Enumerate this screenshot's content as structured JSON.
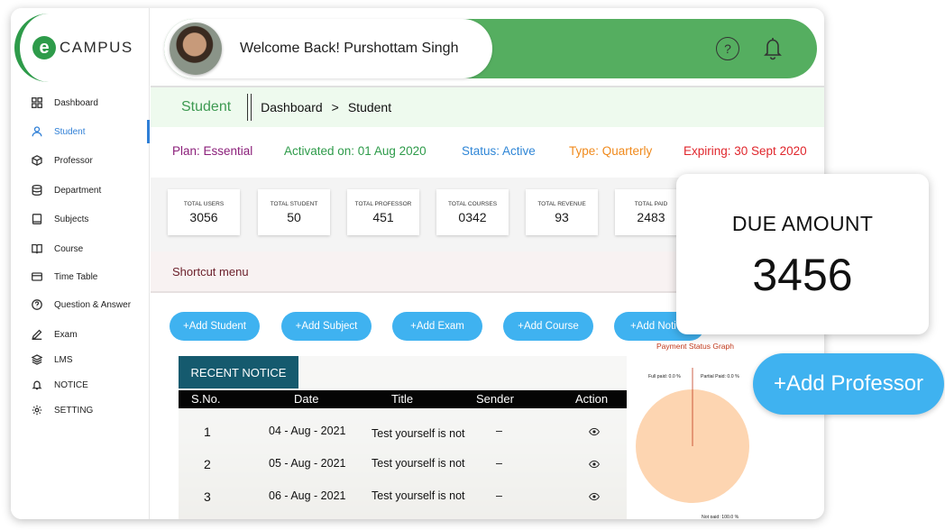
{
  "logo": {
    "badge": "e",
    "text": "CAMPUS"
  },
  "sidebar": {
    "items": [
      {
        "label": "Dashboard",
        "icon": "grid-icon"
      },
      {
        "label": "Student",
        "icon": "user-icon",
        "active": true
      },
      {
        "label": "Professor",
        "icon": "cube-icon"
      },
      {
        "label": "Department",
        "icon": "database-icon"
      },
      {
        "label": "Subjects",
        "icon": "book-icon"
      },
      {
        "label": "Course",
        "icon": "open-book-icon"
      },
      {
        "label": "Time Table",
        "icon": "card-icon"
      },
      {
        "label": "Question & Answer",
        "icon": "question-icon"
      },
      {
        "label": "Exam",
        "icon": "pen-icon"
      },
      {
        "label": "LMS",
        "icon": "layers-icon"
      },
      {
        "label": "NOTICE",
        "icon": "bell-icon"
      },
      {
        "label": "SETTING",
        "icon": "gear-icon"
      }
    ]
  },
  "header": {
    "welcome": "Welcome Back! Purshottam Singh",
    "help": "?"
  },
  "breadcrumb": {
    "section": "Student",
    "root": "Dashboard",
    "arrow": ">",
    "current": "Student"
  },
  "plan": {
    "plan": "Plan: Essential",
    "activated": "Activated on: 01 Aug 2020",
    "status": "Status: Active",
    "type": "Type: Quarterly",
    "expiring": "Expiring: 30 Sept 2020",
    "colors": {
      "plan": "#8b1f7a",
      "activated": "#2e9b4a",
      "status": "#2f86d6",
      "type": "#f08a1c",
      "expiring": "#e0262c"
    }
  },
  "stats": [
    {
      "label": "TOTAL USERS",
      "value": "3056"
    },
    {
      "label": "TOTAL STUDENT",
      "value": "50"
    },
    {
      "label": "TOTAL PROFESSOR",
      "value": "451"
    },
    {
      "label": "TOTAL COURSES",
      "value": "0342"
    },
    {
      "label": "TOTAL REVENUE",
      "value": "93"
    },
    {
      "label": "TOTAL PAID",
      "value": "2483"
    }
  ],
  "shortcut": {
    "title": "Shortcut menu",
    "buttons": [
      "+Add Student",
      "+Add Subject",
      "+Add Exam",
      "+Add Course",
      "+Add Noti"
    ]
  },
  "notice": {
    "title": "RECENT NOTICE",
    "columns": [
      "S.No.",
      "Date",
      "Title",
      "Sender",
      "Action"
    ],
    "rows": [
      {
        "sno": "1",
        "date": "04 - Aug - 2021",
        "title": "Test yourself is not",
        "sender": "–"
      },
      {
        "sno": "2",
        "date": "05 - Aug - 2021",
        "title": "Test yourself is not",
        "sender": "–"
      },
      {
        "sno": "3",
        "date": "06 - Aug - 2021",
        "title": "Test yourself is not",
        "sender": "–"
      }
    ],
    "action_icon": "eye-icon"
  },
  "chart_data": {
    "type": "pie",
    "title": "Payment Status Graph",
    "categories": [
      "Full paid",
      "Partial Paid",
      "Not paid"
    ],
    "values": [
      0.0,
      0.0,
      100.0
    ],
    "labels": [
      "Full paid: 0.0 %",
      "Partial Paid: 0.0 %",
      "Not paid: 100.0 %"
    ],
    "colors": [
      "#c0391b",
      "#e0a060",
      "#fdd5b1"
    ]
  },
  "due": {
    "label": "DUE AMOUNT",
    "value": "3456"
  },
  "add_professor": "+Add Professor"
}
